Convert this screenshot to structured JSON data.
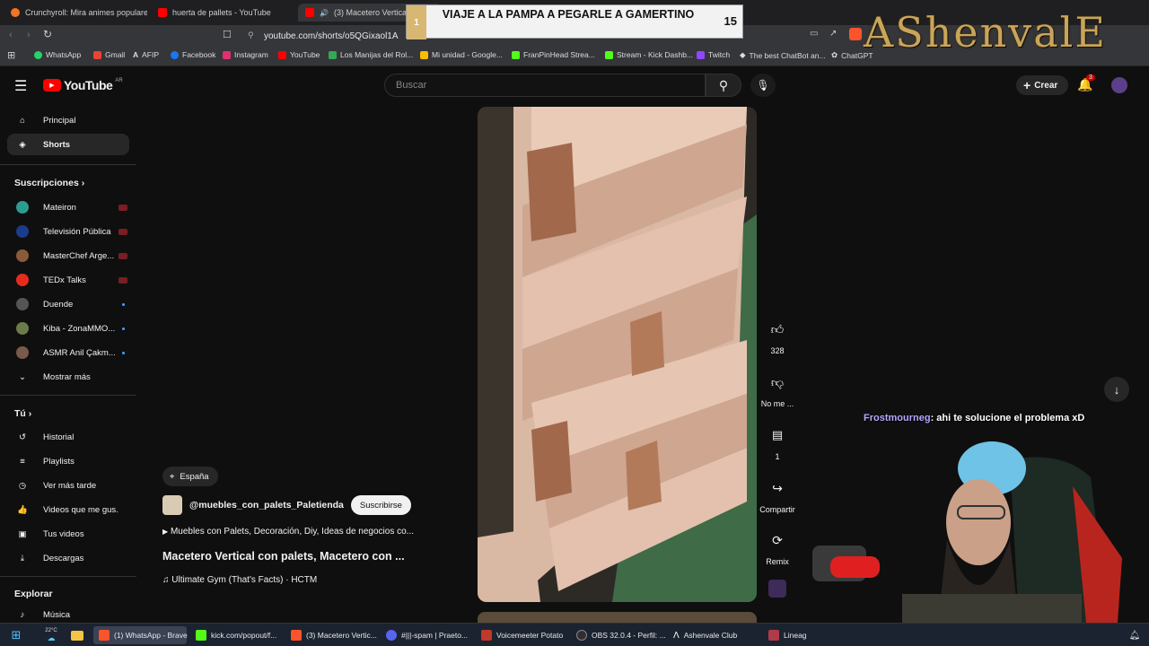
{
  "browser": {
    "tabs": [
      {
        "label": "Crunchyroll: Mira animes populares,",
        "color": "#f47521"
      },
      {
        "label": "huerta de pallets - YouTube",
        "color": "#ff0000"
      },
      {
        "label": "(3) Macetero Vertical con",
        "color": "#ff0000"
      }
    ],
    "url": "youtube.com/shorts/o5QGixaol1A",
    "bookmarks": [
      {
        "label": "WhatsApp",
        "color": "#25d366"
      },
      {
        "label": "Gmail",
        "color": "#ea4335"
      },
      {
        "label": "AFIP",
        "color": "#ffffff"
      },
      {
        "label": "Facebook",
        "color": "#1877f2"
      },
      {
        "label": "Instagram",
        "color": "#e1306c"
      },
      {
        "label": "YouTube",
        "color": "#ff0000"
      },
      {
        "label": "Los Manijas del Rol...",
        "color": "#34a853"
      },
      {
        "label": "Mi unidad - Google...",
        "color": "#fbbc04"
      },
      {
        "label": "FranPinHead Strea...",
        "color": "#53fc18"
      },
      {
        "label": "Stream - Kick Dashb...",
        "color": "#53fc18"
      },
      {
        "label": "Twitch",
        "color": "#9146ff"
      },
      {
        "label": "The best ChatBot an...",
        "color": "#ffffff"
      },
      {
        "label": "ChatGPT",
        "color": "#cccccc"
      }
    ]
  },
  "overlay": {
    "banner_number": "1",
    "banner_title": "VIAJE A LA PAMPA A PEGARLE A GAMERTINO",
    "banner_count": "15",
    "brand": "AShenvalE"
  },
  "youtube": {
    "logo_text": "YouTube",
    "logo_region": "AR",
    "search_placeholder": "Buscar",
    "create_label": "Crear",
    "notif_count": "3",
    "sidebar": {
      "main": [
        {
          "label": "Principal",
          "icon": "home-icon"
        },
        {
          "label": "Shorts",
          "icon": "shorts-icon"
        }
      ],
      "subs_title": "Suscripciones",
      "subs": [
        {
          "label": "Mateiron",
          "color": "#2a9d8f",
          "badge": "live"
        },
        {
          "label": "Televisión Pública",
          "color": "#1a3c8f",
          "badge": "live"
        },
        {
          "label": "MasterChef Arge...",
          "color": "#8a5a3a",
          "badge": "live"
        },
        {
          "label": "TEDx Talks",
          "color": "#e62b1e",
          "badge": "live"
        },
        {
          "label": "Duende",
          "color": "#555555",
          "badge": "dot"
        },
        {
          "label": "Kiba - ZonaMMO...",
          "color": "#6b7b4a",
          "badge": "dot"
        },
        {
          "label": "ASMR Anil Çakm...",
          "color": "#7a5a4a",
          "badge": "dot"
        }
      ],
      "show_more": "Mostrar más",
      "you_title": "Tú",
      "you": [
        {
          "label": "Historial",
          "icon": "history-icon"
        },
        {
          "label": "Playlists",
          "icon": "playlists-icon"
        },
        {
          "label": "Ver más tarde",
          "icon": "clock-icon"
        },
        {
          "label": "Videos que me gus...",
          "icon": "like-icon"
        },
        {
          "label": "Tus videos",
          "icon": "video-icon"
        },
        {
          "label": "Descargas",
          "icon": "download-icon"
        }
      ],
      "explore_title": "Explorar",
      "explore": [
        {
          "label": "Música",
          "icon": "music-icon"
        }
      ]
    },
    "short": {
      "location": "España",
      "channel": "@muebles_con_palets_Paletienda",
      "subscribe": "Suscribirse",
      "description": "Muebles con Palets, Decoración, Diy, Ideas de negocios co...",
      "title": "Macetero Vertical con palets, Macetero con ...",
      "music": "Ultimate Gym (That's Facts) · HCTM",
      "likes": "328",
      "dislike_label": "No me ...",
      "comments": "1",
      "share_label": "Compartir",
      "remix_label": "Remix"
    }
  },
  "chat": {
    "user": "Frostmourneg",
    "message": ": ahi te solucione el problema xD"
  },
  "taskbar": {
    "items": [
      {
        "label": "(1) WhatsApp - Brave",
        "color": "#fb542b"
      },
      {
        "label": "kick.com/popout/f...",
        "color": "#53fc18"
      },
      {
        "label": "(3) Macetero Vertic...",
        "color": "#fb542b"
      },
      {
        "label": "#|||-spam | Praeto...",
        "color": "#5865f2"
      },
      {
        "label": "Voicemeeter Potato",
        "color": "#c0392b"
      },
      {
        "label": "OBS 32.0.4 - Perfil: ...",
        "color": "#302e31"
      },
      {
        "label": "Ashenvale Club",
        "color": "#ffffff"
      },
      {
        "label": "Lineag",
        "color": "#b03a48"
      }
    ],
    "weather": "22°C"
  }
}
